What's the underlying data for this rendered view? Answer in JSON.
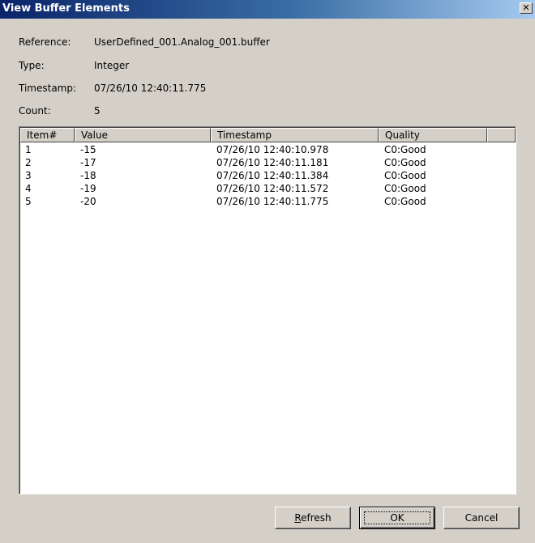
{
  "window": {
    "title": "View Buffer Elements",
    "close_glyph": "✕"
  },
  "info": {
    "reference_label": "Reference:",
    "reference_value": "UserDefined_001.Analog_001.buffer",
    "type_label": "Type:",
    "type_value": "Integer",
    "timestamp_label": "Timestamp:",
    "timestamp_value": "07/26/10 12:40:11.775",
    "count_label": "Count:",
    "count_value": "5"
  },
  "table": {
    "columns": [
      "Item#",
      "Value",
      "Timestamp",
      "Quality"
    ],
    "rows": [
      [
        "1",
        "-15",
        "07/26/10 12:40:10.978",
        "C0:Good"
      ],
      [
        "2",
        "-17",
        "07/26/10 12:40:11.181",
        "C0:Good"
      ],
      [
        "3",
        "-18",
        "07/26/10 12:40:11.384",
        "C0:Good"
      ],
      [
        "4",
        "-19",
        "07/26/10 12:40:11.572",
        "C0:Good"
      ],
      [
        "5",
        "-20",
        "07/26/10 12:40:11.775",
        "C0:Good"
      ]
    ]
  },
  "buttons": {
    "refresh_first": "R",
    "refresh_rest": "efresh",
    "ok": "OK",
    "cancel": "Cancel"
  }
}
